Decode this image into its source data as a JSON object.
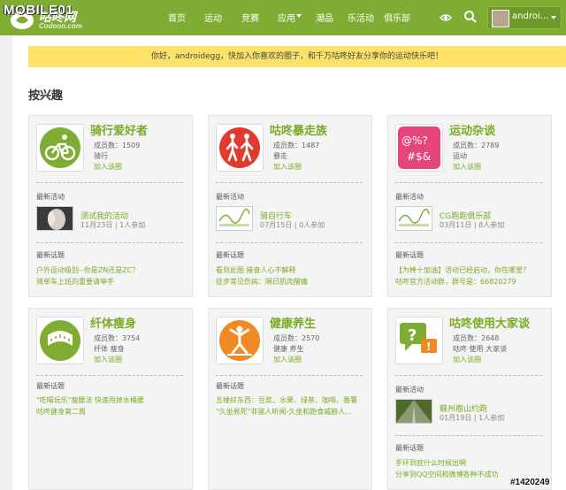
{
  "watermark": "MOBILE01",
  "brand": {
    "name_cn": "咕咚网",
    "name_en": "Codoon.com"
  },
  "nav": {
    "items": [
      "首页",
      "运动",
      "竞赛",
      "应用",
      "潮品",
      "乐活动",
      "俱乐部"
    ]
  },
  "user": {
    "name": "androi..."
  },
  "notice": "你好，androidegg，快加入你喜欢的圈子，和千万咕咚好友分享你的运动快乐吧！",
  "section_title": "按兴趣",
  "labels": {
    "latest_activity": "最新活动",
    "latest_topics": "最新话题"
  },
  "groups": [
    {
      "name": "骑行爱好者",
      "members": "成员数：1509",
      "tags": "骑行",
      "join": "加入该圈",
      "activity": {
        "title": "测试我的活动",
        "meta": "11月23日 | 1人参加"
      },
      "topics": [
        "户外运动级别--你是ZN还是ZC？",
        "骑单车上班的重要请举手"
      ]
    },
    {
      "name": "咕咚暴走族",
      "members": "成员数：1487",
      "tags": "暴走",
      "join": "加入该圈",
      "activity": {
        "title": "骑自行车",
        "meta": "07月15日 | 0人参加"
      },
      "topics": [
        "看到此图 摧奋人心不解释",
        "徒步常见伤病：隔日肌肉酸痛"
      ]
    },
    {
      "name": "运动杂谈",
      "members": "成员数：2789",
      "tags": "运动",
      "join": "加入该圈",
      "activity": {
        "title": "CG跑跑俱乐部",
        "meta": "03月11日 | 8人参加"
      },
      "topics": [
        "【为棒十加油】活动已经启动，你在哪里？",
        "咕咚官方活动群，群号是：66820279"
      ]
    },
    {
      "name": "纤体瘦身",
      "members": "成员数：3754",
      "tags": "纤体  瘦身",
      "join": "加入该圈",
      "topics": [
        "\"吃喝玩乐\"瘦腰法 快速甩掉水桶腰",
        "咕咚健身第二周"
      ]
    },
    {
      "name": "健康养生",
      "members": "成员数：2570",
      "tags": "健康  养生",
      "join": "加入该圈",
      "topics": [
        "五楼好东西：豆浆、水果、绿茶、咖啡、番薯",
        "\"久坐易死\"非骇人听闻-久坐和跑食威胁人..."
      ]
    },
    {
      "name": "咕咚使用大家谈",
      "members": "成员数：2648",
      "tags": "咕咚  使用  大家谈",
      "join": "加入该圈",
      "activity": {
        "title": "蘇州樹山约跑",
        "meta": "01月19日 | 1人参加"
      },
      "topics": [
        "手环到底什么时候出啊",
        "分享到QQ空间和微博各种不成功"
      ]
    }
  ],
  "stamp": "#1420249",
  "colors": {
    "brand_green": "#7fad34",
    "accent_green": "#7aab25",
    "notice_yellow": "#fde26a"
  }
}
